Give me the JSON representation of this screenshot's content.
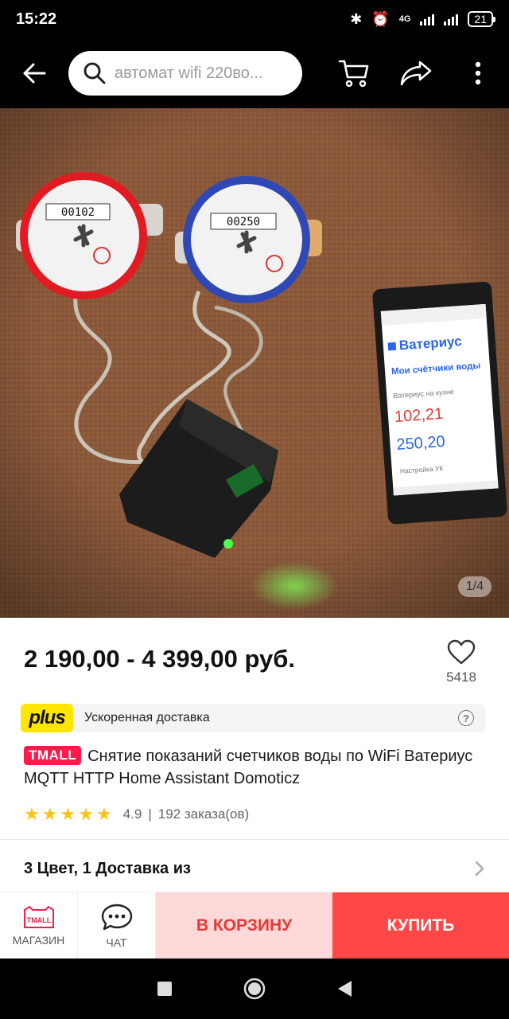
{
  "status_bar": {
    "time": "15:22",
    "network": "4G",
    "battery": "21"
  },
  "search": {
    "placeholder": "автомат wifi 220во..."
  },
  "gallery": {
    "page_indicator": "1/4",
    "phone_screen": {
      "brand": "Ватериус",
      "heading": "Мои счётчики воды",
      "meter_label": "Ватериус на кухне",
      "value_hot": "102,21",
      "value_cold": "250,20",
      "settings": "Настройка УК"
    },
    "meter_hot_digits": "00102",
    "meter_cold_digits": "00250"
  },
  "product": {
    "price": "2 190,00 - 4 399,00 руб.",
    "favorites_count": "5418",
    "plus_badge": "plus",
    "plus_text": "Ускоренная доставка",
    "tmall_badge": "TMALL",
    "title": "Снятие показаний счетчиков воды по WiFi Ватериус MQTT HTTP Home Assistant Domoticz",
    "rating": "4.9",
    "rating_stars": 5,
    "orders": "192 заказа(ов)",
    "options": "3 Цвет, 1 Доставка из"
  },
  "actions": {
    "store_badge": "TMALL",
    "store_label": "МАГАЗИН",
    "chat_label": "ЧАТ",
    "cart_label": "В КОРЗИНУ",
    "buy_label": "КУПИТЬ"
  },
  "colors": {
    "buy": "#ff4747",
    "cart_bg": "#ffd9d9",
    "cart_text": "#e53935",
    "tmall": "#ff1a4b",
    "plus": "#ffe600",
    "star": "#fcc419"
  }
}
